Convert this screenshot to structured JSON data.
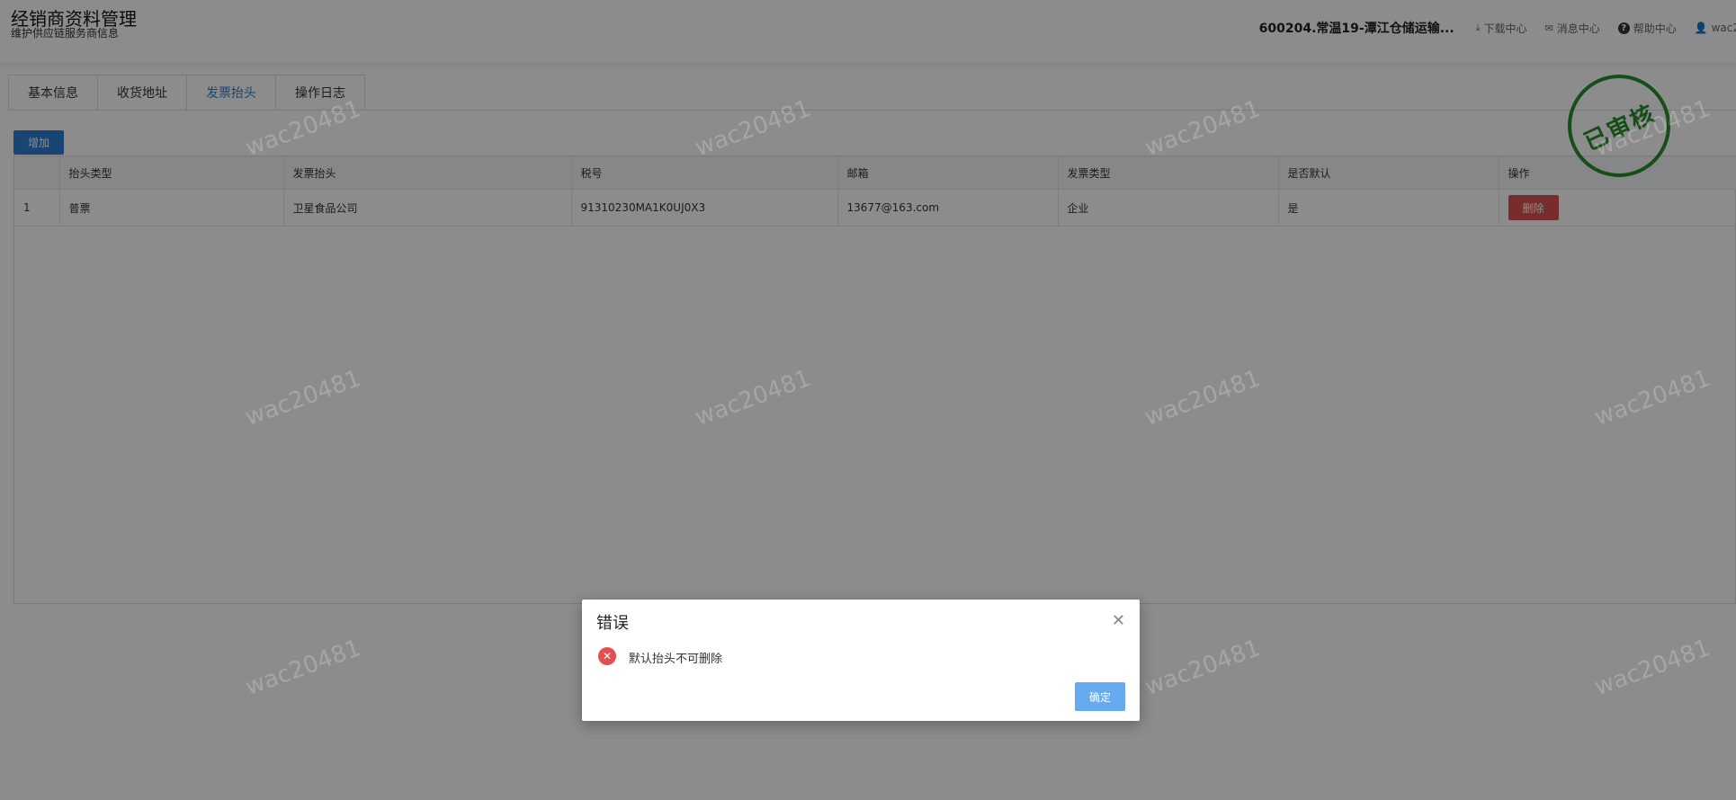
{
  "header": {
    "title": "经销商资料管理",
    "subtitle": "维护供应链服务商信息",
    "store_name": "600204.常温19-潭江仓储运输...",
    "links": [
      {
        "label": "下载中心",
        "icon": "download-icon"
      },
      {
        "label": "消息中心",
        "icon": "mail-icon"
      },
      {
        "label": "帮助中心",
        "icon": "help-icon"
      }
    ],
    "user": "wac2"
  },
  "tabs": [
    "基本信息",
    "收货地址",
    "发票抬头",
    "操作日志"
  ],
  "active_tab": "发票抬头",
  "toolbar": {
    "add_label": "增加"
  },
  "table": {
    "columns": [
      "",
      "抬头类型",
      "发票抬头",
      "税号",
      "邮箱",
      "发票类型",
      "是否默认",
      "操作"
    ],
    "rows": [
      {
        "index": "1",
        "type": "普票",
        "title": "卫星食品公司",
        "tax_id": "91310230MA1K0UJ0X3",
        "email": "13677@163.com",
        "invoice_type": "企业",
        "is_default": "是",
        "action": "删除"
      }
    ]
  },
  "stamp": "已审核",
  "watermark": "wac20481",
  "dialog": {
    "title": "错误",
    "message": "默认抬头不可删除",
    "ok_label": "确定",
    "close_icon": "close-icon",
    "status_icon": "error-icon"
  },
  "colors": {
    "primary": "#2d7fd1",
    "danger": "#d9534f",
    "stamp": "#2a8f2a"
  }
}
